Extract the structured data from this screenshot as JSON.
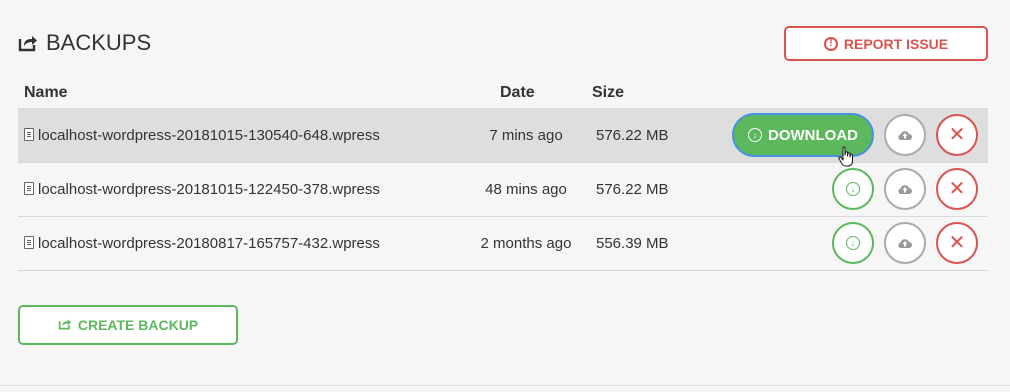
{
  "header": {
    "title": "BACKUPS",
    "report_label": "REPORT ISSUE"
  },
  "table": {
    "columns": [
      "Name",
      "Date",
      "Size"
    ],
    "rows": [
      {
        "name": "localhost-wordpress-20181015-130540-648.wpress",
        "date": "7 mins ago",
        "size": "576.22 MB",
        "download_label": "DOWNLOAD",
        "hovered": true
      },
      {
        "name": "localhost-wordpress-20181015-122450-378.wpress",
        "date": "48 mins ago",
        "size": "576.22 MB",
        "hovered": false
      },
      {
        "name": "localhost-wordpress-20180817-165757-432.wpress",
        "date": "2 months ago",
        "size": "556.39 MB",
        "hovered": false
      }
    ]
  },
  "footer": {
    "create_label": "CREATE BACKUP"
  },
  "icons": {
    "export": "export-icon",
    "report": "exclamation-circle-icon",
    "file": "file-icon",
    "download": "download-icon",
    "restore": "cloud-icon",
    "delete": "close-icon",
    "cursor": "hand-pointer-icon"
  },
  "colors": {
    "green": "#5cb85c",
    "red": "#d9534f",
    "gray": "#aaaaaa",
    "hover_row": "#dedede",
    "focus_border": "#4a90e2"
  }
}
